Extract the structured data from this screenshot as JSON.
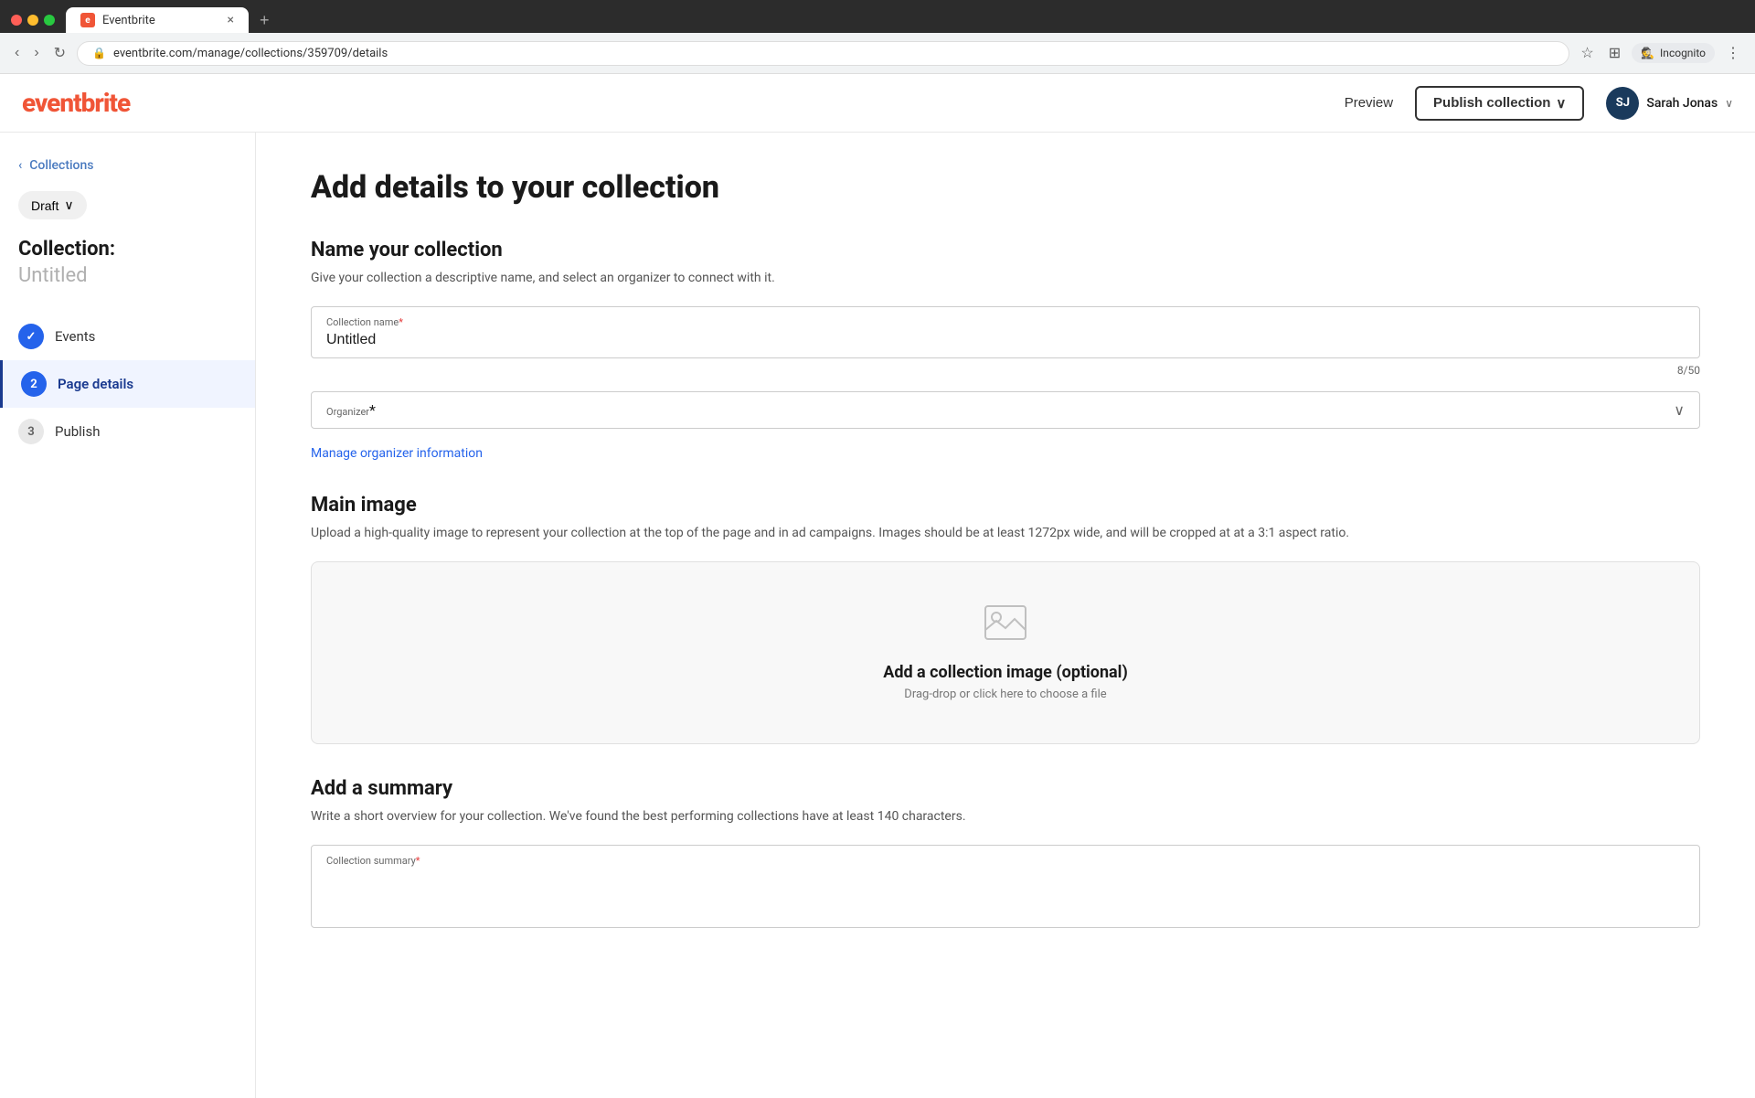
{
  "browser": {
    "tab_favicon": "e",
    "tab_title": "Eventbrite",
    "tab_close": "×",
    "tab_new": "+",
    "url": "eventbrite.com/manage/collections/359709/details",
    "nav_back": "‹",
    "nav_forward": "›",
    "nav_refresh": "↻",
    "lock_icon": "🔒",
    "chevron_more": "⋮",
    "bookmark_icon": "☆",
    "extensions_icon": "⊞",
    "incognito_label": "Incognito",
    "incognito_icon": "🕵"
  },
  "topnav": {
    "logo": "eventbrite",
    "preview_label": "Preview",
    "publish_label": "Publish collection",
    "publish_chevron": "∨",
    "user_initials": "SJ",
    "user_name": "Sarah Jonas",
    "user_chevron": "∨"
  },
  "sidebar": {
    "back_arrow": "‹",
    "back_label": "Collections",
    "draft_label": "Draft",
    "draft_chevron": "∨",
    "collection_label": "Collection:",
    "collection_name": "Untitled",
    "nav_items": [
      {
        "id": "events",
        "step": "✓",
        "label": "Events",
        "state": "done"
      },
      {
        "id": "page-details",
        "step": "2",
        "label": "Page details",
        "state": "active"
      },
      {
        "id": "publish",
        "step": "3",
        "label": "Publish",
        "state": "todo"
      }
    ]
  },
  "main": {
    "page_title": "Add details to your collection",
    "name_section": {
      "title": "Name your collection",
      "description": "Give your collection a descriptive name, and select an organizer to connect with it.",
      "collection_name_label": "Collection name",
      "collection_name_required": "*",
      "collection_name_value": "Untitled",
      "char_count": "8/50",
      "organizer_label": "Organizer",
      "organizer_required": "*",
      "organizer_chevron": "∨",
      "manage_link": "Manage organizer information"
    },
    "image_section": {
      "title": "Main image",
      "description": "Upload a high-quality image to represent your collection at the top of the page and in ad campaigns. Images should be at least 1272px wide, and will be cropped at at a 3:1 aspect ratio.",
      "upload_icon": "🖼",
      "upload_title": "Add a collection image (optional)",
      "upload_sub": "Drag-drop or click here to choose a file"
    },
    "summary_section": {
      "title": "Add a summary",
      "description": "Write a short overview for your collection. We've found the best performing collections have at least 140 characters.",
      "summary_label": "Collection summary",
      "summary_required": "*"
    }
  }
}
